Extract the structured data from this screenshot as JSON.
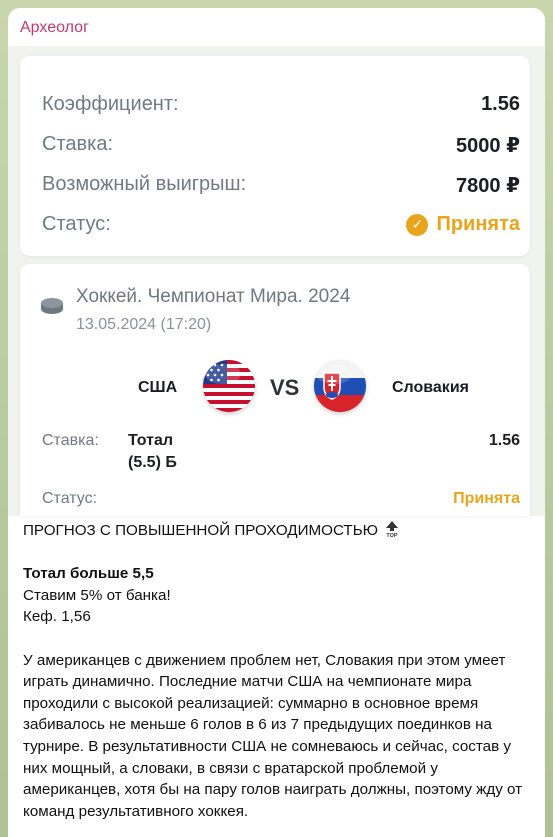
{
  "sender": "Археолог",
  "bet_summary": {
    "rows": [
      {
        "label": "Коэффициент:",
        "value": "1.56"
      },
      {
        "label": "Ставка:",
        "value": "5000 ₽"
      },
      {
        "label": "Возможный выигрыш:",
        "value": "7800 ₽"
      },
      {
        "label": "Статус:",
        "value": "Принята"
      }
    ]
  },
  "event": {
    "icon": "hockey-puck-icon",
    "title": "Хоккей. Чемпионат Мира. 2024",
    "date": "13.05.2024 (17:20)",
    "team1": "США",
    "team2": "Словакия",
    "vs": "VS",
    "bet_label": "Ставка:",
    "bet_line1": "Тотал",
    "bet_line2": "(5.5) Б",
    "odds": "1.56",
    "status_label": "Статус:",
    "status_value": "Принята"
  },
  "message": {
    "headline": "ПРОГНОЗ С ПОВЫШЕННОЙ ПРОХОДИМОСТЬЮ",
    "headline_emoji": "top-arrow-icon",
    "bold_line": "Тотал больше 5,5",
    "line2": "Ставим 5% от банка!",
    "line3": "Кеф. 1,56",
    "paragraph": "У американцев с движением проблем нет, Словакия при этом умеет играть динамично. Последние матчи США на чемпионате мира проходили с высокой реализацией: суммарно в основное время забивалось не меньше 6 голов в 6 из 7 предыдущих поединков на турнире. В результативности США не сомневаюсь и сейчас, состав у них мощный, а словаки, в связи с вратарской проблемой у американцев, хотя бы на пару голов наиграть должны, поэтому жду от команд результативного хоккея."
  },
  "colors": {
    "accent": "#e8a51c",
    "sender": "#c03a73"
  }
}
